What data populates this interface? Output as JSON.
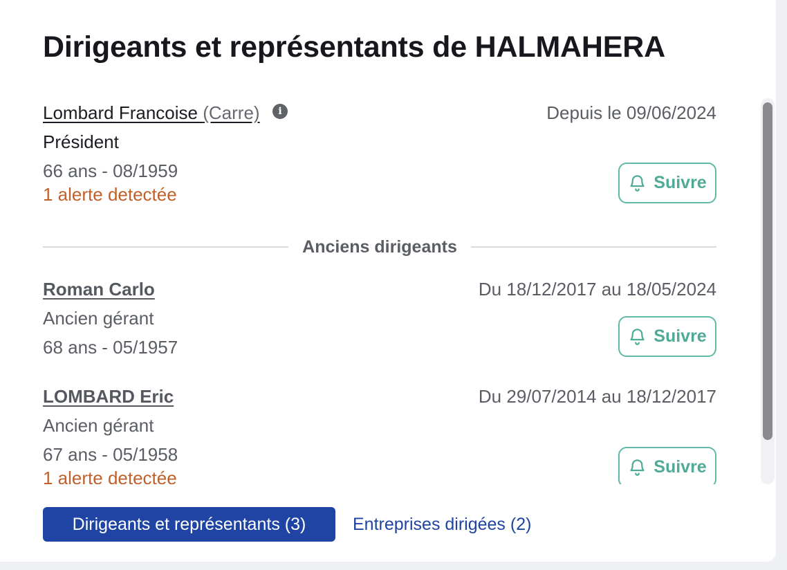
{
  "header": {
    "title": "Dirigeants et représentants de HALMAHERA"
  },
  "current_leader": {
    "name": "Lombard Francoise",
    "usage_name": "(Carre)",
    "info_icon": "i",
    "dates": "Depuis le 09/06/2024",
    "role": "Président",
    "age": "66 ans - 08/1959",
    "alert": "1 alerte detectée",
    "follow_label": "Suivre"
  },
  "former_section": {
    "label": "Anciens dirigeants"
  },
  "former_leaders": [
    {
      "name": "Roman Carlo",
      "dates": "Du 18/12/2017 au 18/05/2024",
      "role": "Ancien gérant",
      "age": "68 ans - 05/1957",
      "follow_label": "Suivre"
    },
    {
      "name": "LOMBARD Eric",
      "dates": "Du 29/07/2014 au 18/12/2017",
      "role": "Ancien gérant",
      "age": "67 ans - 05/1958",
      "alert": "1 alerte detectée",
      "follow_label": "Suivre"
    }
  ],
  "tabs": [
    {
      "label": "Dirigeants et représentants (3)",
      "active": true
    },
    {
      "label": "Entreprises dirigées (2)",
      "active": false
    }
  ],
  "icons": {
    "follow": "bell-icon",
    "info": "info-icon"
  },
  "colors": {
    "primary": "#1f44a3",
    "follow": "#4faa97",
    "alert": "#c0602a",
    "text": "#1b1d22",
    "muted": "#5a5e64"
  }
}
